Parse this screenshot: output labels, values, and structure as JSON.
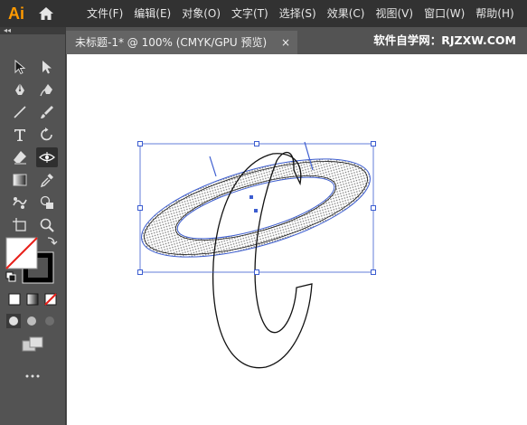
{
  "app": {
    "logo": "Ai"
  },
  "menu": [
    "文件(F)",
    "编辑(E)",
    "对象(O)",
    "文字(T)",
    "选择(S)",
    "效果(C)",
    "视图(V)",
    "窗口(W)",
    "帮助(H)"
  ],
  "toolbar": {
    "collapse_label": "◂◂"
  },
  "tools": [
    "selection-tool-icon",
    "direct-selection-tool-icon",
    "pen-tool-icon",
    "curvature-tool-icon",
    "line-segment-tool-icon",
    "paintbrush-tool-icon",
    "type-tool-icon",
    "rotate-tool-icon",
    "eraser-tool-icon",
    "width-tool-icon",
    "gradient-tool-icon",
    "eyedropper-tool-icon",
    "puppet-warp-tool-icon",
    "shape-builder-tool-icon",
    "artboard-tool-icon",
    "zoom-tool-icon"
  ],
  "document": {
    "tab_title": "未标题-1* @ 100% (CMYK/GPU 预览)",
    "close_label": "×",
    "watermark": "软件自学网：RJZXW.COM"
  },
  "colors": {
    "accent": "#3c5dd0",
    "logo": "#ff9a00",
    "menubar": "#323232",
    "panel": "#535353",
    "canvas": "#ffffff"
  }
}
